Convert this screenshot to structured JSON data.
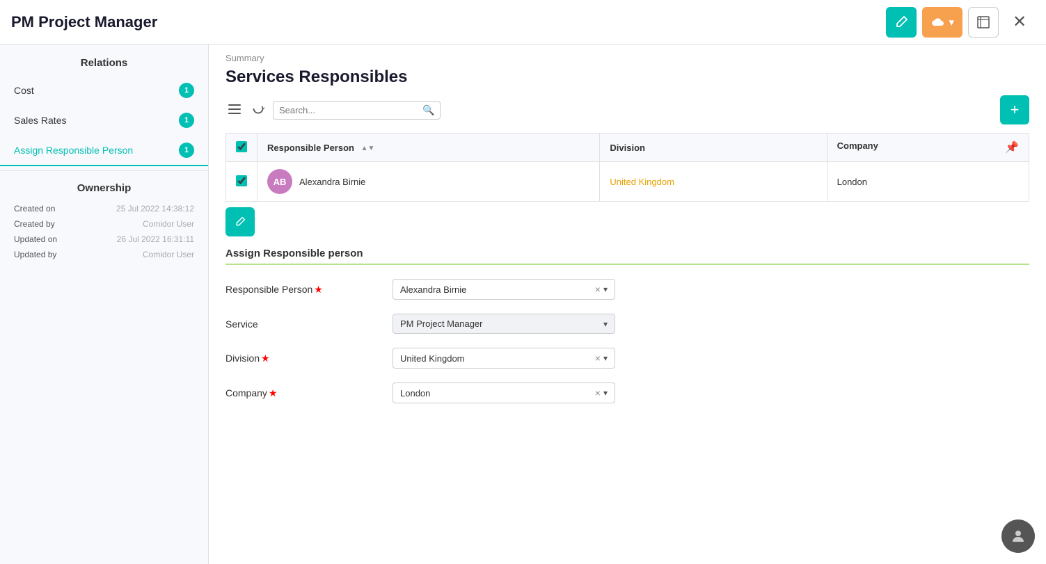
{
  "app": {
    "title": "PM Project Manager"
  },
  "header": {
    "edit_icon": "✎",
    "cloud_icon": "☁",
    "dropdown_arrow": "▾",
    "expand_icon": "⛶",
    "close_icon": "✕"
  },
  "sidebar": {
    "relations_title": "Relations",
    "items": [
      {
        "label": "Cost",
        "badge": "1",
        "active": false
      },
      {
        "label": "Sales Rates",
        "badge": "1",
        "active": false
      },
      {
        "label": "Assign Responsible Person",
        "badge": "1",
        "active": true
      }
    ],
    "ownership_title": "Ownership",
    "meta": [
      {
        "label": "Created on",
        "value": "25 Jul 2022 14:38:12"
      },
      {
        "label": "Created by",
        "value": "Comidor User"
      },
      {
        "label": "Updated on",
        "value": "26 Jul 2022 16:31:11"
      },
      {
        "label": "Updated by",
        "value": "Comidor User"
      }
    ]
  },
  "content": {
    "breadcrumb": "Summary",
    "heading": "Services Responsibles",
    "search_placeholder": "Search...",
    "add_button_label": "+",
    "table": {
      "columns": [
        {
          "label": "Responsible Person",
          "sortable": true
        },
        {
          "label": "Division",
          "sortable": false
        },
        {
          "label": "Company",
          "sortable": false
        }
      ],
      "rows": [
        {
          "avatar_initials": "AB",
          "responsible_person": "Alexandra Birnie",
          "division": "United Kingdom",
          "company": "London"
        }
      ]
    },
    "form": {
      "title": "Assign Responsible person",
      "fields": [
        {
          "label": "Responsible Person",
          "required": true,
          "value": "Alexandra Birnie",
          "clearable": true,
          "dropdown": true,
          "disabled": false
        },
        {
          "label": "Service",
          "required": false,
          "value": "PM Project Manager",
          "clearable": false,
          "dropdown": true,
          "disabled": true
        },
        {
          "label": "Division",
          "required": true,
          "value": "United Kingdom",
          "clearable": true,
          "dropdown": true,
          "disabled": false
        },
        {
          "label": "Company",
          "required": true,
          "value": "London",
          "clearable": true,
          "dropdown": true,
          "disabled": false
        }
      ]
    }
  },
  "colors": {
    "teal": "#00bfb3",
    "orange": "#f7a14e",
    "division_text": "#e8a000"
  }
}
